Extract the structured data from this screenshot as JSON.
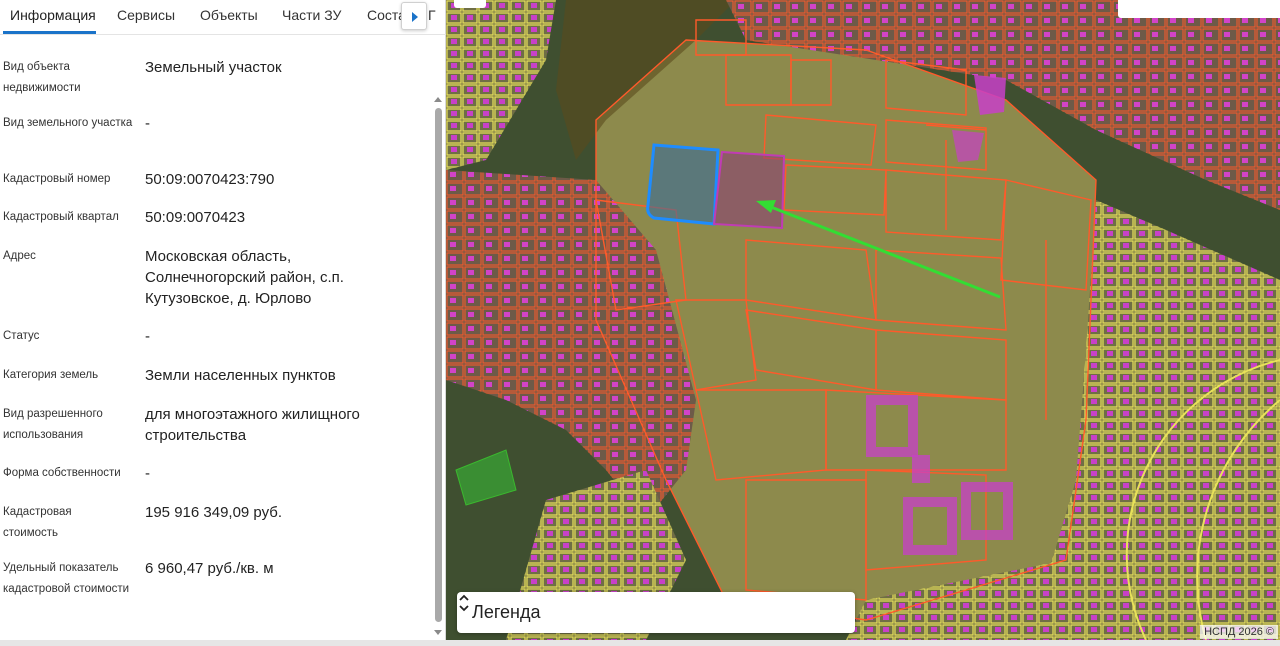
{
  "tabs": [
    {
      "label": "Информация"
    },
    {
      "label": "Сервисы"
    },
    {
      "label": "Объекты"
    },
    {
      "label": "Части ЗУ"
    },
    {
      "label": "Соста"
    }
  ],
  "tabs_overflow_fragment": "Г",
  "fields": [
    {
      "label": "Вид объекта недвижимости",
      "value": "Земельный участок"
    },
    {
      "label": "Вид земельного участка",
      "value": "-"
    },
    {
      "label": "Кадастровый номер",
      "value": "50:09:0070423:790"
    },
    {
      "label": "Кадастровый квартал",
      "value": "50:09:0070423"
    },
    {
      "label": "Адрес",
      "value": "Московская область, Солнечногорский район, с.п. Кутузовское, д. Юрлово"
    },
    {
      "label": "Статус",
      "value": "-"
    },
    {
      "label": "Категория земель",
      "value": "Земли населенных пунктов"
    },
    {
      "label": "Вид разрешенного использования",
      "value": "для многоэтажного жилищного строительства"
    },
    {
      "label": "Форма собственности",
      "value": "-"
    },
    {
      "label": "Кадастровая стоимость",
      "value": "195 916 349,09 руб."
    },
    {
      "label": "Удельный показатель кадастровой стоимости",
      "value": "6 960,47 руб./кв. м"
    }
  ],
  "map": {
    "legend_title": "Легенда",
    "attribution": "НСПД 2026 ©",
    "colors": {
      "parcel_outline": "#ff5a2a",
      "selected_parcel": "#1e8cff",
      "highlighted_parcel": "#c03cb4",
      "building": "#d23cd2",
      "residential_zone": "#e8e25a",
      "arrow": "#33dd33",
      "forest_zone": "#6b5a1a"
    }
  },
  "icons": {
    "tab_next": "chevron-right-icon",
    "legend_toggle": "chevron-up-down-icon"
  }
}
